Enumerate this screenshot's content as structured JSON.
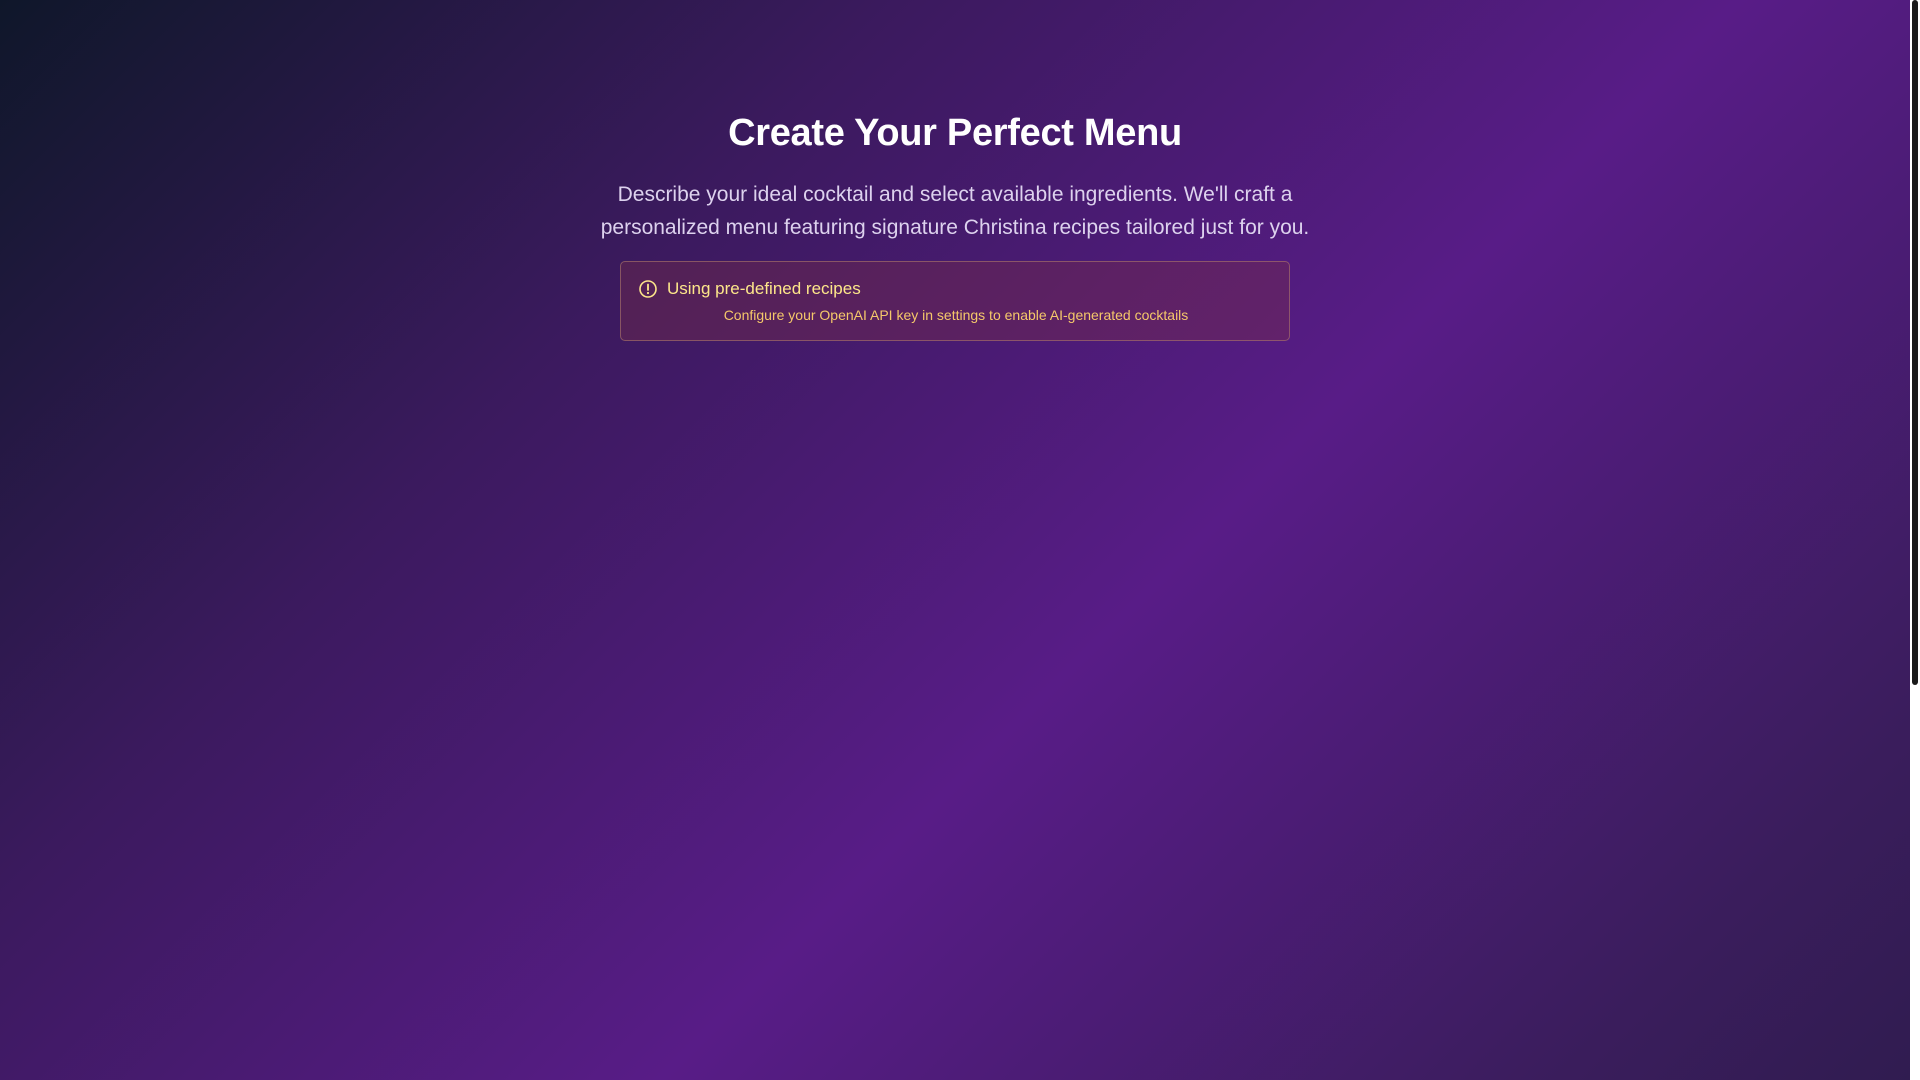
{
  "hero": {
    "title": "Create Your Perfect Menu",
    "subtitle": "Describe your ideal cocktail and select available ingredients. We'll craft a personalized menu featuring signature Christina recipes tailored just for you."
  },
  "notice": {
    "icon": "alert-circle-icon",
    "title": "Using pre-defined recipes",
    "description": "Configure your OpenAI API key in settings to enable AI-generated cocktails",
    "color": "#fde68a"
  }
}
